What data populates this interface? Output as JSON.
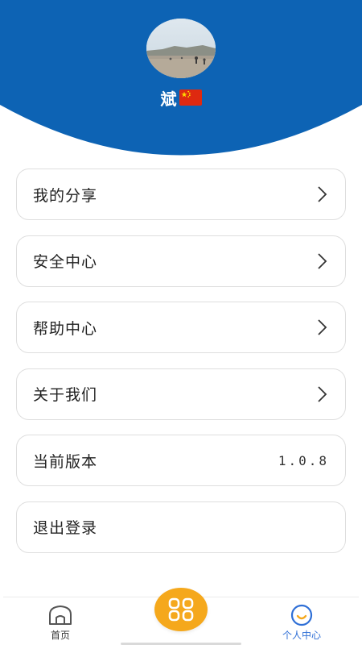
{
  "profile": {
    "username": "斌",
    "flag_icon": "china-flag-icon"
  },
  "colors": {
    "header_blue": "#0d63b4",
    "accent_orange": "#f5a81c",
    "active_tab_blue": "#2f6fd6"
  },
  "menu": {
    "items": [
      {
        "label": "我的分享",
        "icon": "chevron-right-icon"
      },
      {
        "label": "安全中心",
        "icon": "chevron-right-icon"
      },
      {
        "label": "帮助中心",
        "icon": "chevron-right-icon"
      },
      {
        "label": "关于我们",
        "icon": "chevron-right-icon"
      },
      {
        "label": "当前版本",
        "value": "1.0.8"
      },
      {
        "label": "退出登录"
      }
    ]
  },
  "bottom_nav": {
    "home_label": "首页",
    "home_icon": "home-icon",
    "center_icon": "apps-grid-icon",
    "profile_label": "个人中心",
    "profile_icon": "smiley-icon",
    "active_tab": "个人中心"
  }
}
